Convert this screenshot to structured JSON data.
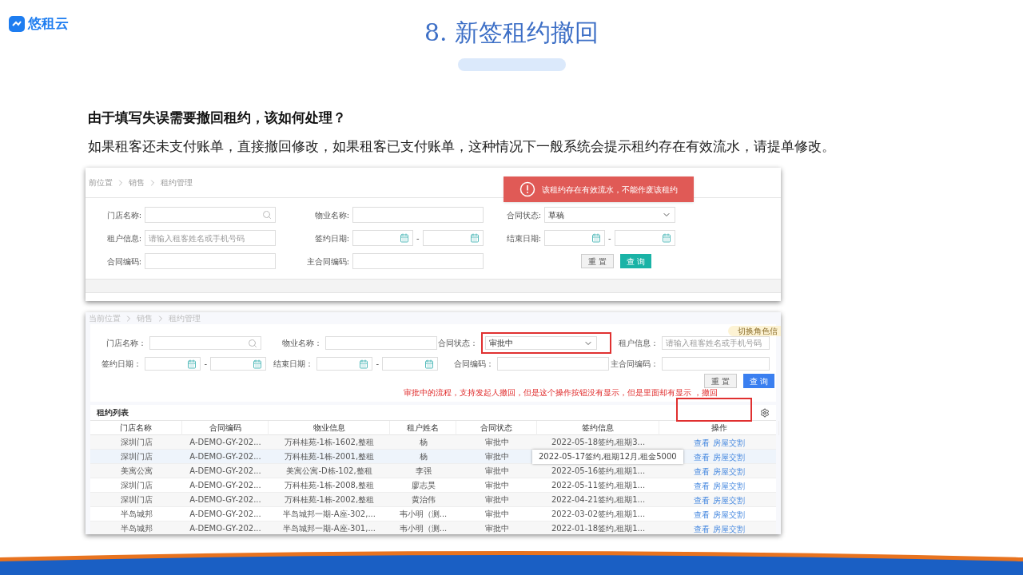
{
  "logo": {
    "text": "悠租云"
  },
  "title": "8. 新签租约撤回",
  "question": "由于填写失误需要撤回租约，该如何处理？",
  "answer": "如果租客还未支付账单，直接撤回修改，如果租客已支付账单，这种情况下一般系统会提示租约存在有效流水，请提单修改。",
  "screens": [
    {
      "breadcrumb": [
        "前位置",
        "销售",
        "租约管理"
      ],
      "toast": {
        "text": "该租约存在有效流水，不能作废该租约"
      },
      "fields": [
        {
          "kind": "search",
          "label": "门店名称:",
          "highlighted": false
        },
        {
          "kind": "text",
          "label": "物业名称:",
          "highlighted": false
        },
        {
          "kind": "select",
          "label": "合同状态:",
          "value": "草稿",
          "highlighted": false
        },
        {
          "kind": "text",
          "label": "租户信息:",
          "placeholder": "请输入租客姓名或手机号码",
          "highlighted": false
        },
        {
          "kind": "date_range",
          "label": "签约日期:",
          "separator": "-",
          "highlighted": false
        },
        {
          "kind": "date_range",
          "label": "结束日期:",
          "separator": "-",
          "highlighted": false
        },
        {
          "kind": "text",
          "label": "合同编码:",
          "highlighted": false
        },
        {
          "kind": "text",
          "label": "主合同编码:",
          "highlighted": false
        }
      ],
      "buttons": [
        {
          "kind": "reset",
          "label": "重 置"
        },
        {
          "kind": "primary",
          "label": "查 询"
        }
      ]
    },
    {
      "breadcrumb": [
        "当前位置",
        "销售",
        "租约管理"
      ],
      "role_badge": "切换角色信",
      "fields": [
        {
          "kind": "search",
          "label": "门店名称：",
          "highlighted": false
        },
        {
          "kind": "text",
          "label": "物业名称：",
          "highlighted": false
        },
        {
          "kind": "select",
          "label": "合同状态：",
          "value": "审批中",
          "highlighted": true
        },
        {
          "kind": "text",
          "label": "租户信息：",
          "placeholder": "请输入租客姓名或手机号码",
          "highlighted": false
        },
        {
          "kind": "date_range",
          "label": "签约日期：",
          "separator": "-",
          "highlighted": false
        },
        {
          "kind": "date_range",
          "label": "结束日期：",
          "separator": "-",
          "highlighted": false
        },
        {
          "kind": "text",
          "label": "合同编码：",
          "highlighted": false
        },
        {
          "kind": "text",
          "label": "主合同编码：",
          "highlighted": false
        }
      ],
      "buttons": [
        {
          "kind": "reset",
          "label": "重 置"
        },
        {
          "kind": "primary",
          "label": "查 询"
        }
      ],
      "annotation": "审批中的流程，支持发起人撤回，但是这个操作按钮没有显示，但是里面却有显示 ，撤回",
      "table": {
        "title": "租约列表",
        "columns": [
          "门店名称",
          "合同编码",
          "物业信息",
          "租户姓名",
          "合同状态",
          "签约信息",
          "操作"
        ],
        "rows": [
          {
            "store": "深圳门店",
            "code": "A-DEMO-GY-202...",
            "property": "万科桂苑-1栋-1602,整租",
            "tenant": "杨",
            "status": "审批中",
            "sign": "2022-05-18签约,租期3...",
            "popup": false,
            "hovered": false,
            "actions": [
              "查看",
              "房屋交割"
            ]
          },
          {
            "store": "深圳门店",
            "code": "A-DEMO-GY-202...",
            "property": "万科桂苑-1栋-2001,整租",
            "tenant": "杨",
            "status": "审批中",
            "sign": "2022-05-17签约,租期12月,租金5000",
            "popup": true,
            "hovered": true,
            "actions": [
              "查看",
              "房屋交割"
            ]
          },
          {
            "store": "美寓公寓",
            "code": "A-DEMO-GY-202...",
            "property": "美寓公寓-D栋-102,整租",
            "tenant": "李强",
            "status": "审批中",
            "sign": "2022-05-16签约,租期1...",
            "popup": false,
            "hovered": false,
            "actions": [
              "查看",
              "房屋交割"
            ]
          },
          {
            "store": "深圳门店",
            "code": "A-DEMO-GY-202...",
            "property": "万科桂苑-1栋-2008,整租",
            "tenant": "廖志昊",
            "status": "审批中",
            "sign": "2022-05-11签约,租期1...",
            "popup": false,
            "hovered": false,
            "actions": [
              "查看",
              "房屋交割"
            ]
          },
          {
            "store": "深圳门店",
            "code": "A-DEMO-GY-202...",
            "property": "万科桂苑-1栋-2002,整租",
            "tenant": "黄治伟",
            "status": "审批中",
            "sign": "2022-04-21签约,租期1...",
            "popup": false,
            "hovered": false,
            "actions": [
              "查看",
              "房屋交割"
            ]
          },
          {
            "store": "半岛城邦",
            "code": "A-DEMO-GY-202...",
            "property": "半岛城邦一期-A座-302,...",
            "tenant": "韦小明（测...",
            "status": "审批中",
            "sign": "2022-03-02签约,租期1...",
            "popup": false,
            "hovered": false,
            "actions": [
              "查看",
              "房屋交割"
            ]
          },
          {
            "store": "半岛城邦",
            "code": "A-DEMO-GY-202...",
            "property": "半岛城邦一期-A座-301,...",
            "tenant": "韦小明（测...",
            "status": "审批中",
            "sign": "2022-01-18签约,租期1...",
            "popup": false,
            "hovered": false,
            "actions": [
              "查看",
              "房屋交割"
            ]
          }
        ]
      }
    }
  ]
}
